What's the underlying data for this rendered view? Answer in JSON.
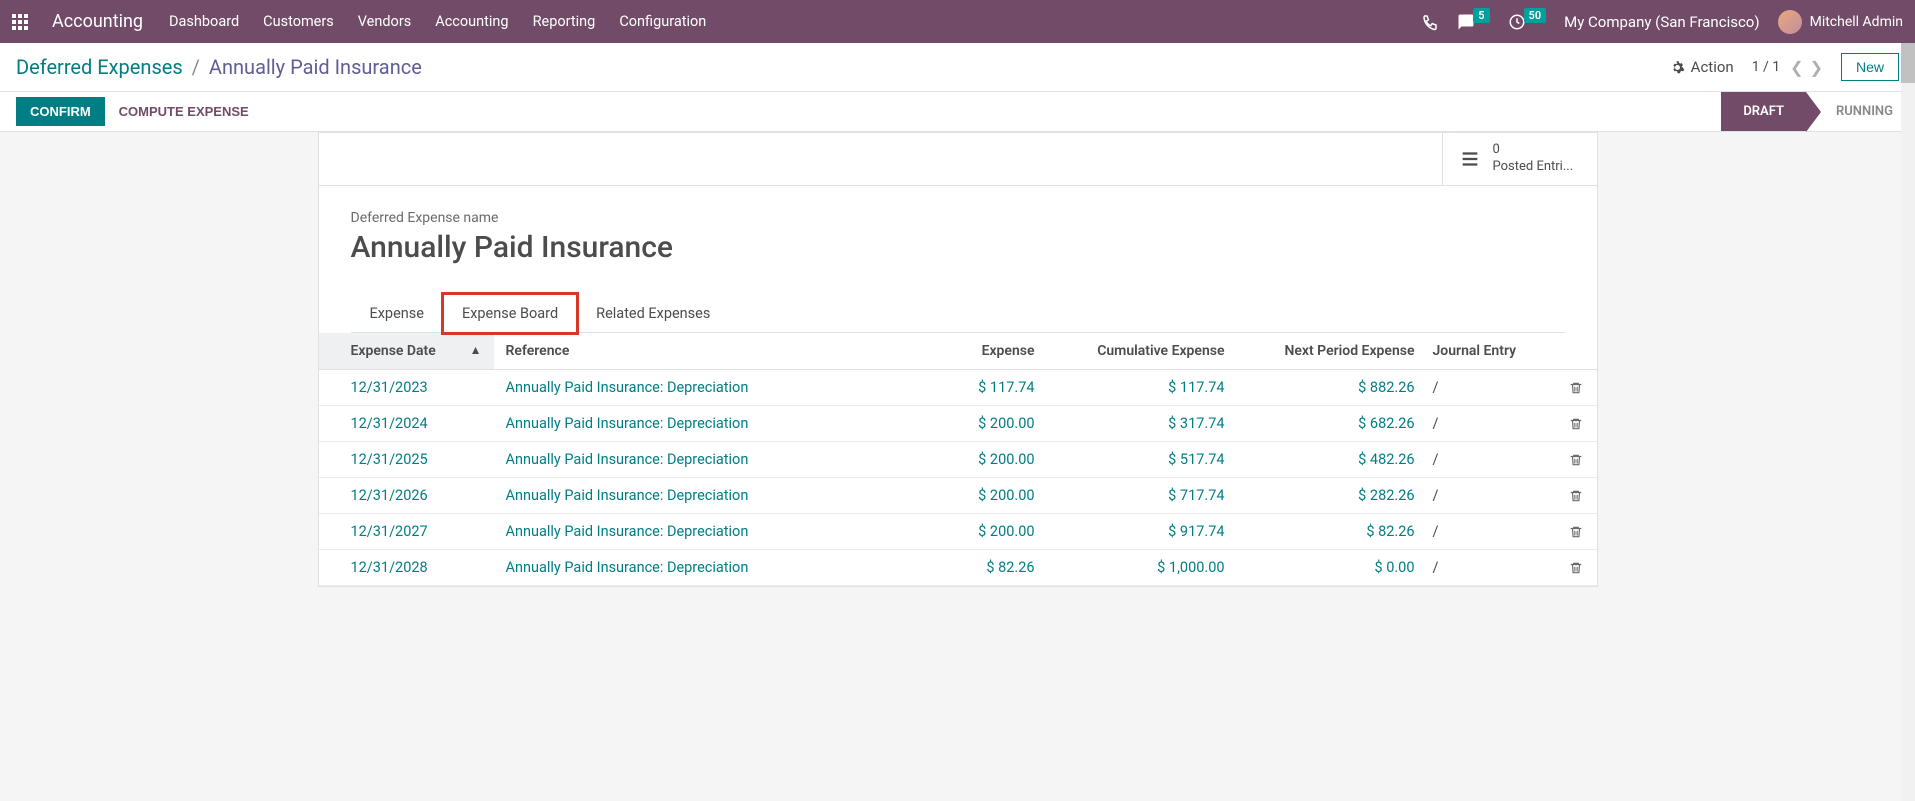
{
  "nav": {
    "app_title": "Accounting",
    "menus": [
      "Dashboard",
      "Customers",
      "Vendors",
      "Accounting",
      "Reporting",
      "Configuration"
    ],
    "chat_badge": "5",
    "activity_badge": "50",
    "company": "My Company (San Francisco)",
    "user": "Mitchell Admin"
  },
  "control": {
    "breadcrumb_root": "Deferred Expenses",
    "breadcrumb_current": "Annually Paid Insurance",
    "action_label": "Action",
    "pager": "1 / 1",
    "new_label": "New"
  },
  "status": {
    "confirm": "CONFIRM",
    "compute": "COMPUTE EXPENSE",
    "draft": "DRAFT",
    "running": "RUNNING"
  },
  "sheet": {
    "stat_count": "0",
    "stat_label": "Posted Entri...",
    "field_label": "Deferred Expense name",
    "title": "Annually Paid Insurance",
    "tabs": {
      "expense": "Expense",
      "board": "Expense Board",
      "related": "Related Expenses"
    }
  },
  "table": {
    "headers": {
      "date": "Expense Date",
      "ref": "Reference",
      "expense": "Expense",
      "cumulative": "Cumulative Expense",
      "next": "Next Period Expense",
      "journal": "Journal Entry"
    },
    "rows": [
      {
        "date": "12/31/2023",
        "ref": "Annually Paid Insurance: Depreciation",
        "expense": "$ 117.74",
        "cumulative": "$ 117.74",
        "next": "$ 882.26",
        "journal": "/"
      },
      {
        "date": "12/31/2024",
        "ref": "Annually Paid Insurance: Depreciation",
        "expense": "$ 200.00",
        "cumulative": "$ 317.74",
        "next": "$ 682.26",
        "journal": "/"
      },
      {
        "date": "12/31/2025",
        "ref": "Annually Paid Insurance: Depreciation",
        "expense": "$ 200.00",
        "cumulative": "$ 517.74",
        "next": "$ 482.26",
        "journal": "/"
      },
      {
        "date": "12/31/2026",
        "ref": "Annually Paid Insurance: Depreciation",
        "expense": "$ 200.00",
        "cumulative": "$ 717.74",
        "next": "$ 282.26",
        "journal": "/"
      },
      {
        "date": "12/31/2027",
        "ref": "Annually Paid Insurance: Depreciation",
        "expense": "$ 200.00",
        "cumulative": "$ 917.74",
        "next": "$ 82.26",
        "journal": "/"
      },
      {
        "date": "12/31/2028",
        "ref": "Annually Paid Insurance: Depreciation",
        "expense": "$ 82.26",
        "cumulative": "$ 1,000.00",
        "next": "$ 0.00",
        "journal": "/"
      }
    ]
  }
}
